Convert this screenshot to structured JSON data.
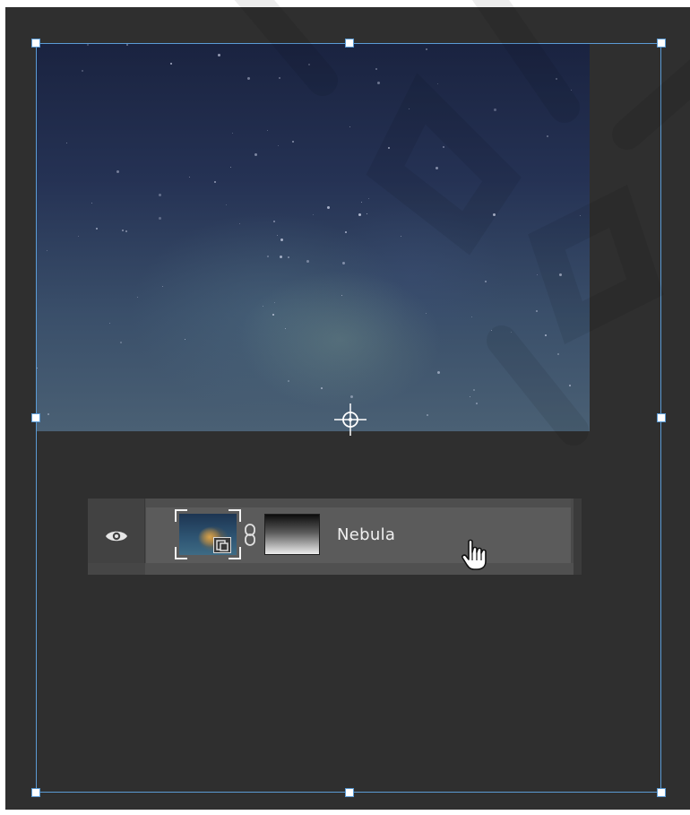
{
  "layers_panel": {
    "layer": {
      "name": "Nebula",
      "visible": true,
      "type": "smart-object",
      "has_layer_mask": true,
      "mask_linked": true
    }
  },
  "icons": {
    "visibility": "eye-icon",
    "smart_object": "smart-object-badge-icon",
    "link": "chain-link-icon",
    "reference_point": "crosshair-reference-point-icon",
    "cursor": "hand-pointer-cursor-icon"
  },
  "colors": {
    "canvas_background": "#2f2f2f",
    "transform_box": "#5b9bd5",
    "layer_row_selected": "#5b5b5b",
    "layer_text": "#f0f0f0"
  }
}
